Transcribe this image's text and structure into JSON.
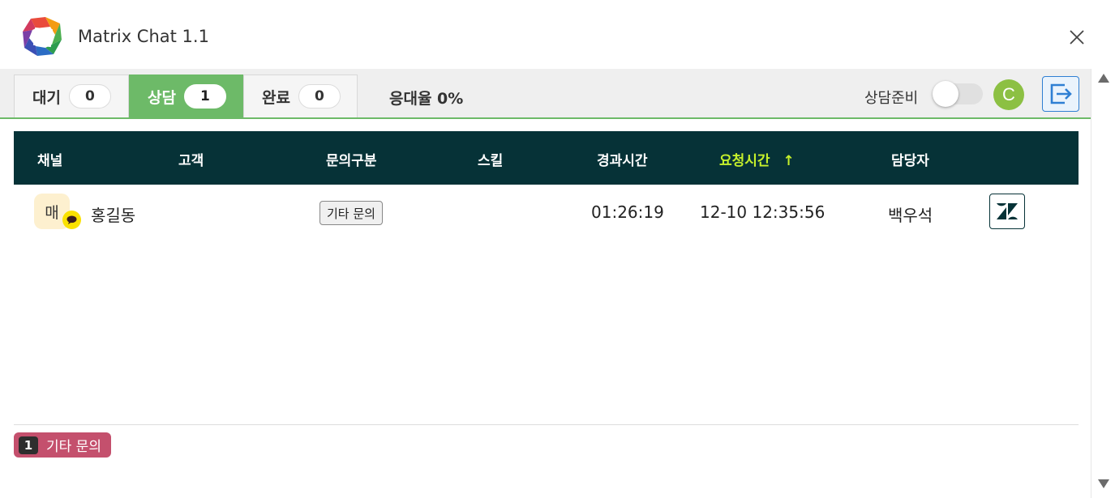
{
  "window": {
    "title": "Matrix Chat 1.1",
    "logo_icon": "matrix-chat-logo",
    "close_icon": "close-icon"
  },
  "toolbar": {
    "tabs": [
      {
        "label": "대기",
        "count": "0",
        "active": false
      },
      {
        "label": "상담",
        "count": "1",
        "active": true
      },
      {
        "label": "완료",
        "count": "0",
        "active": false
      }
    ],
    "response_rate": "응대율 0%",
    "ready_label": "상담준비",
    "ready_toggle_on": false,
    "status_initial": "C",
    "accent_color": "#6dba68"
  },
  "table": {
    "headers": {
      "channel": "채널",
      "customer": "고객",
      "category": "문의구분",
      "skill": "스킬",
      "elapsed": "경과시간",
      "requested": "요청시간",
      "agent": "담당자"
    },
    "sort_indicator": "↑",
    "rows": [
      {
        "channel_badge": "매",
        "channel_icon": "kakao-chat-icon",
        "customer": "홍길동",
        "category": "기타 문의",
        "skill": "",
        "elapsed": "01:26:19",
        "requested": "12-10 12:35:56",
        "agent": "백우석",
        "action_icon": "zendesk-icon"
      }
    ]
  },
  "summary": {
    "count": "1",
    "label": "기타 문의",
    "color": "#c4506d"
  }
}
